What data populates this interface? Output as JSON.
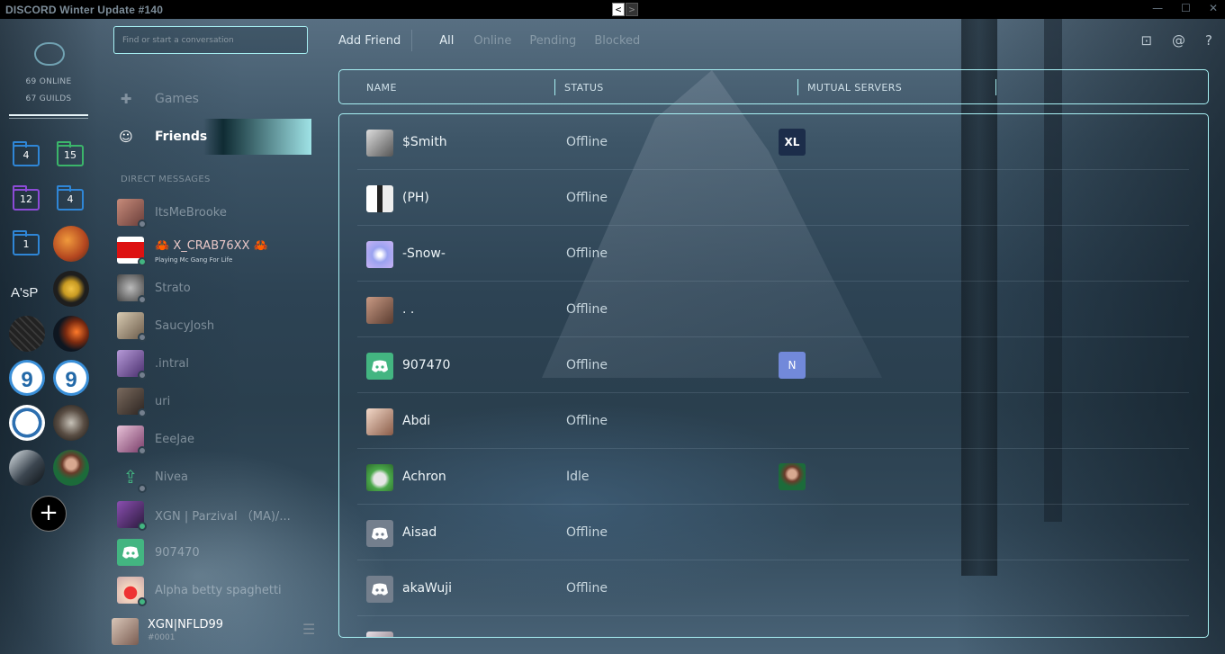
{
  "window": {
    "title": "DISCORD Winter Update #140",
    "back": "<",
    "forward": ">",
    "controls": [
      "—",
      "☐",
      "✕"
    ]
  },
  "guilds": {
    "online": "69 ONLINE",
    "count": "67 GUILDS",
    "folders": [
      {
        "badge": "4"
      },
      {
        "badge": "15"
      },
      {
        "badge": "12"
      },
      {
        "badge": "4"
      },
      {
        "badge": "1"
      }
    ],
    "asp_label": "A'sP",
    "add": "+"
  },
  "sidebar": {
    "search_placeholder": "Find or start a conversation",
    "games": "Games",
    "friends": "Friends",
    "dm_heading": "DIRECT MESSAGES",
    "dms": [
      {
        "name": "ItsMeBrooke"
      },
      {
        "name": "🦀 X_CRAB76XX 🦀",
        "activity": "Playing Mc Gang For Life"
      },
      {
        "name": "Strato"
      },
      {
        "name": "SaucyJosh"
      },
      {
        "name": ".intral"
      },
      {
        "name": "uri"
      },
      {
        "name": "EeeJae"
      },
      {
        "name": "Nivea"
      },
      {
        "name": "XGN | Parzival （MA)/..."
      },
      {
        "name": "907470"
      },
      {
        "name": "Alpha betty spaghetti"
      }
    ],
    "user": {
      "name": "XGN|NFLD99",
      "tag": "#0001"
    }
  },
  "main": {
    "tabs": {
      "add": "Add Friend",
      "all": "All",
      "online": "Online",
      "pending": "Pending",
      "blocked": "Blocked"
    },
    "columns": {
      "name": "NAME",
      "status": "STATUS",
      "mutual": "MUTUAL SERVERS"
    },
    "friends": [
      {
        "name": "$Smith",
        "status": "Offline",
        "mutual": "XL"
      },
      {
        "name": "(PH)",
        "status": "Offline",
        "mutual": ""
      },
      {
        "name": "-Snow-",
        "status": "Offline",
        "mutual": ""
      },
      {
        "name": ". .",
        "status": "Offline",
        "mutual": ""
      },
      {
        "name": "907470",
        "status": "Offline",
        "mutual": "N"
      },
      {
        "name": "Abdi",
        "status": "Offline",
        "mutual": ""
      },
      {
        "name": "Achron",
        "status": "Idle",
        "mutual": ""
      },
      {
        "name": "Aisad",
        "status": "Offline",
        "mutual": ""
      },
      {
        "name": "akaWuji",
        "status": "Offline",
        "mutual": ""
      }
    ]
  }
}
